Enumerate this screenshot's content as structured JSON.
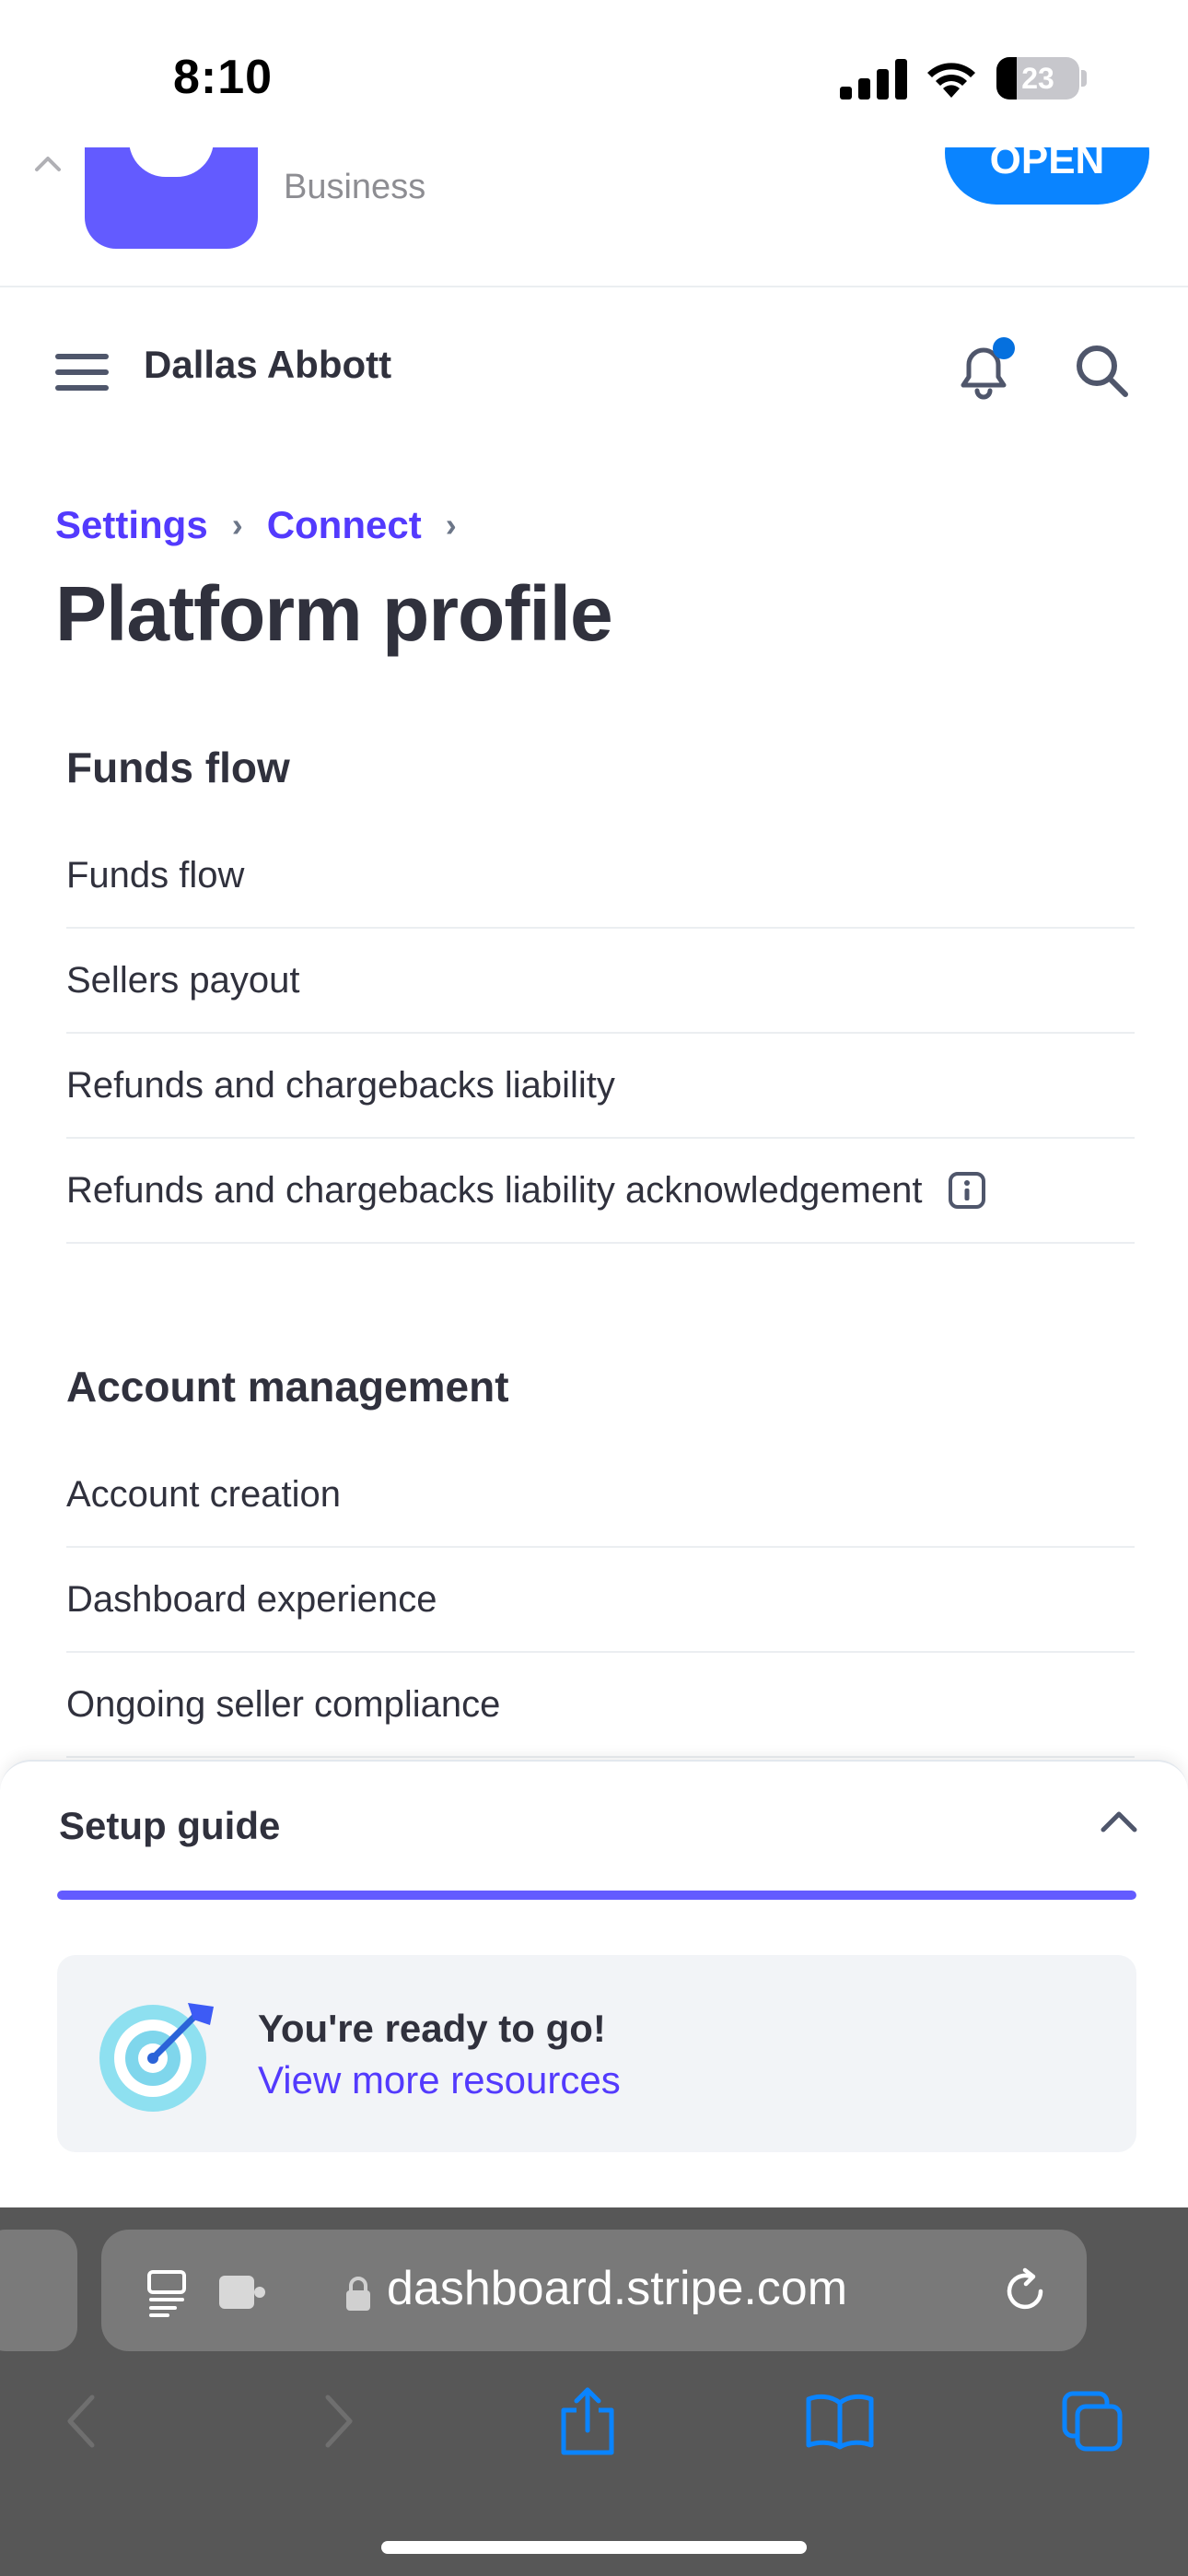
{
  "status_bar": {
    "time": "8:10",
    "battery": "23"
  },
  "app_banner": {
    "subtitle": "Business",
    "open_label": "OPEN"
  },
  "header": {
    "user_name": "Dallas Abbott"
  },
  "breadcrumb": {
    "items": [
      "Settings",
      "Connect"
    ]
  },
  "page_title": "Platform profile",
  "sections": [
    {
      "title": "Funds flow",
      "items": [
        "Funds flow",
        "Sellers payout",
        "Refunds and chargebacks liability",
        "Refunds and chargebacks liability acknowledgement"
      ]
    },
    {
      "title": "Account management",
      "items": [
        "Account creation",
        "Dashboard experience",
        "Ongoing seller compliance"
      ]
    }
  ],
  "setup_guide": {
    "title": "Setup guide",
    "progress_percent": 100,
    "ready_title": "You're ready to go!",
    "ready_link": "View more resources"
  },
  "browser": {
    "url": "dashboard.stripe.com"
  },
  "colors": {
    "accent": "#533afd",
    "brand": "#635bff",
    "ios_blue": "#0a84ff",
    "notification_dot": "#0570de"
  }
}
